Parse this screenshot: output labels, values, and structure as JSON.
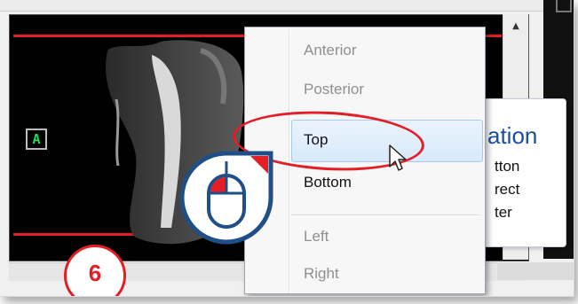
{
  "viewer": {
    "orientation_marker": "A"
  },
  "context_menu": {
    "items": [
      {
        "label": "Anterior",
        "state": "disabled"
      },
      {
        "label": "Posterior",
        "state": "disabled"
      },
      {
        "label": "Top",
        "state": "highlighted"
      },
      {
        "label": "Bottom",
        "state": "enabled"
      },
      {
        "label": "Left",
        "state": "disabled"
      },
      {
        "label": "Right",
        "state": "disabled"
      }
    ]
  },
  "tooltip": {
    "title_fragment": "ation",
    "line1": "tton",
    "line2": "rect",
    "line3": "ter"
  },
  "callout": {
    "step_number": "6",
    "icon": "mouse-left-click-icon"
  },
  "colors": {
    "accent_red": "#e31e24",
    "badge_blue": "#1f4f86",
    "marker_green": "#22e05a"
  }
}
